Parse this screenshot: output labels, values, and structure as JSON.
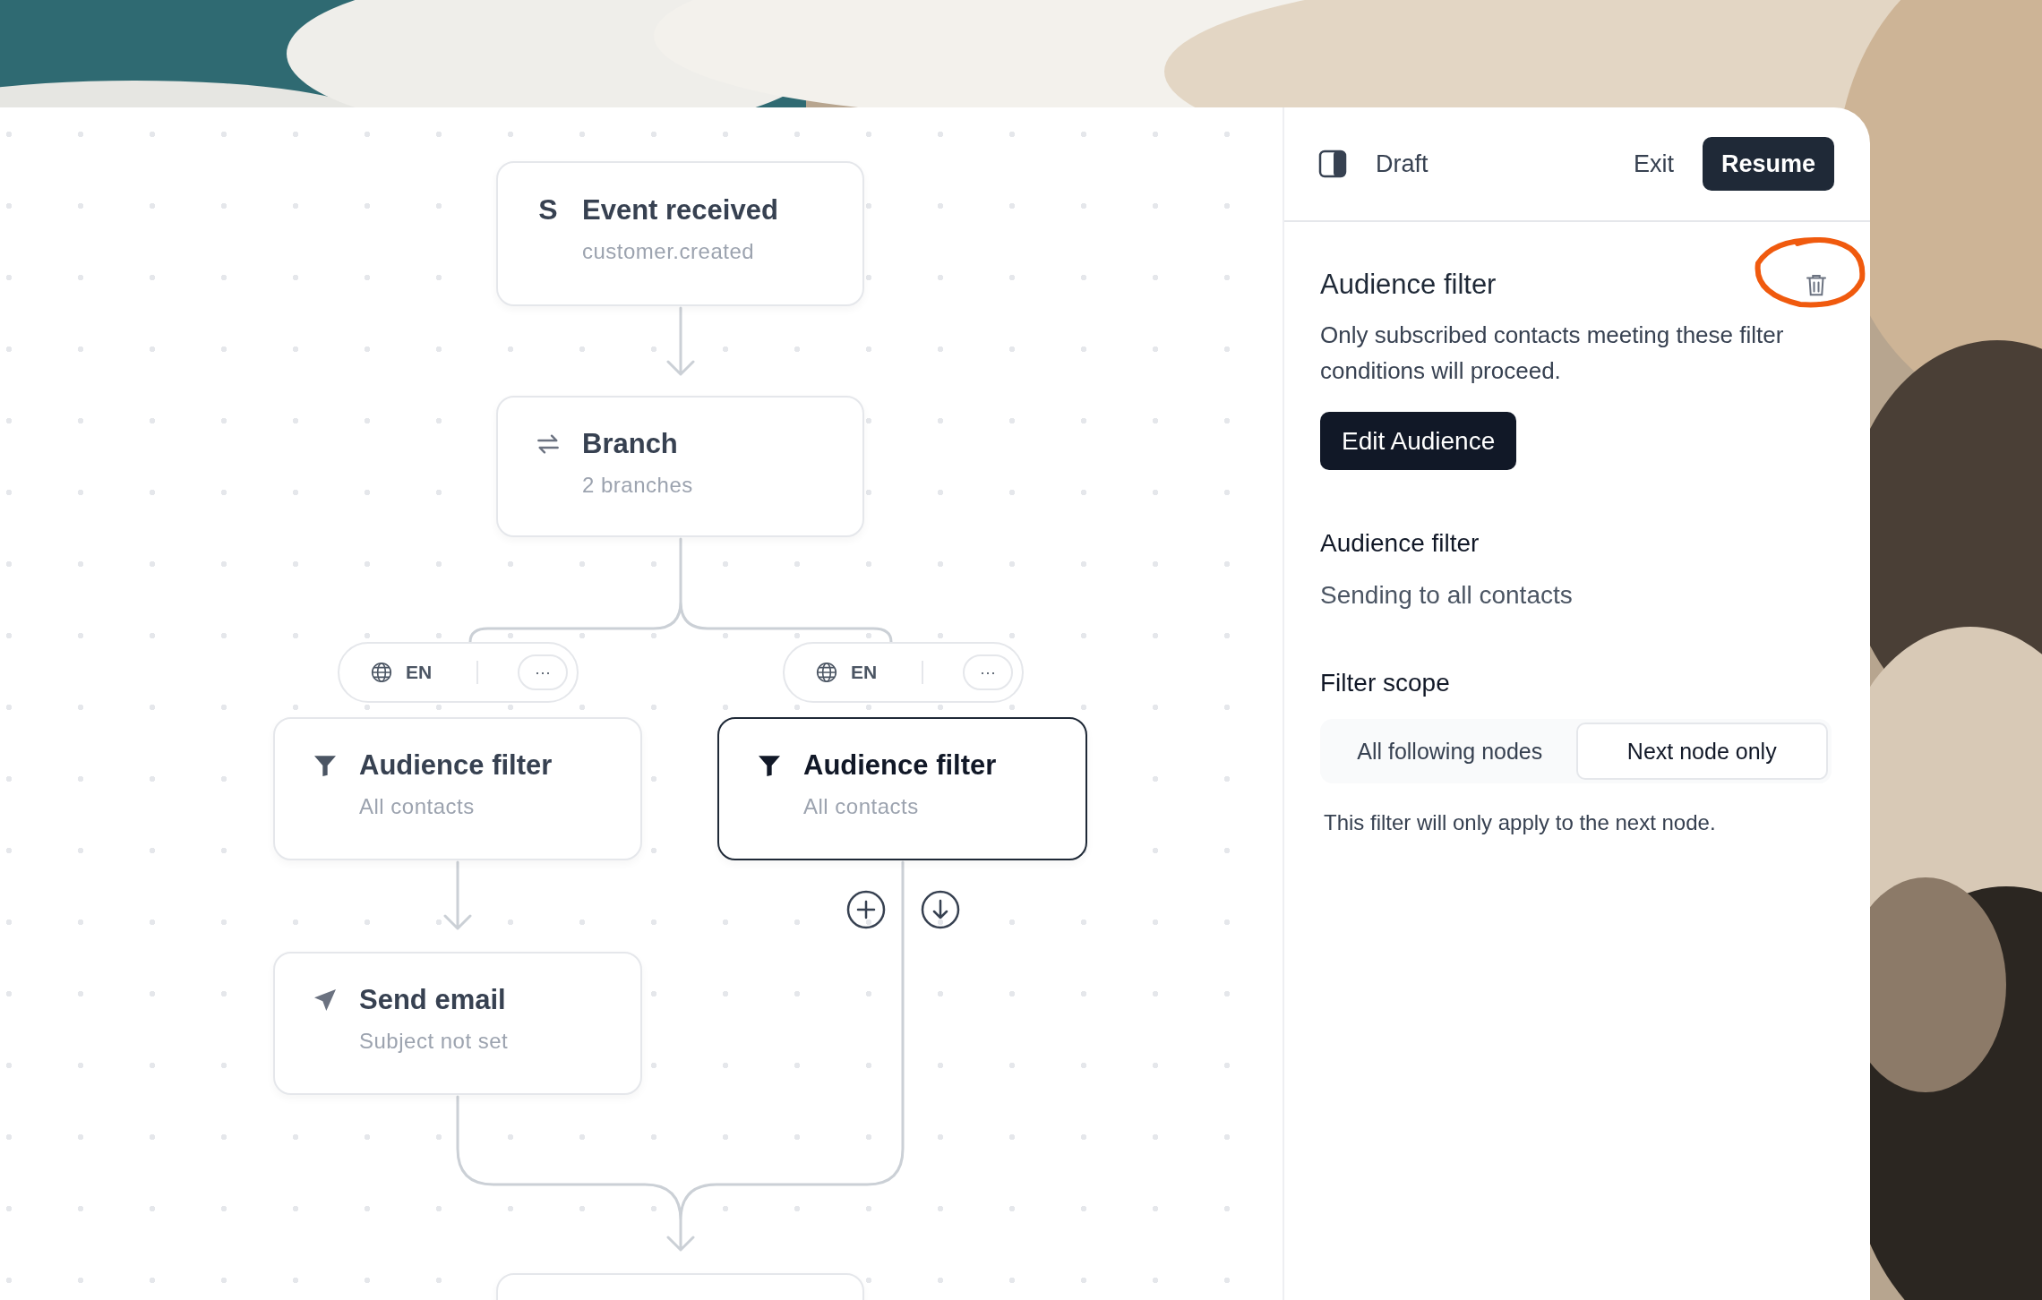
{
  "editor": {
    "nodes": [
      {
        "kind": "event",
        "source": "S",
        "title": "Event received",
        "subtitle": "customer.created",
        "selected": false
      },
      {
        "kind": "branch",
        "title": "Branch",
        "subtitle": "2 branches",
        "selected": false
      },
      {
        "kind": "filter",
        "title": "Audience filter",
        "subtitle": "All contacts",
        "selected": false
      },
      {
        "kind": "filter",
        "title": "Audience filter",
        "subtitle": "All contacts",
        "selected": true
      },
      {
        "kind": "email",
        "title": "Send email",
        "subtitle": "Subject not set",
        "selected": false
      },
      {
        "kind": "partial",
        "selected": false
      }
    ],
    "branch_pills": [
      {
        "language": "EN",
        "more": "···"
      },
      {
        "language": "EN",
        "more": "···"
      }
    ]
  },
  "panel": {
    "header": {
      "status": "Draft",
      "exit": "Exit",
      "resume": "Resume"
    },
    "section": {
      "title": "Audience filter",
      "description": "Only subscribed contacts meeting these filter conditions will proceed.",
      "button": "Edit Audience"
    },
    "audience": {
      "label": "Audience filter",
      "value": "Sending to all contacts"
    },
    "scope": {
      "label": "Filter scope",
      "options": [
        {
          "label": "All following nodes",
          "selected": false
        },
        {
          "label": "Next node only",
          "selected": true
        }
      ],
      "hint": "This filter will only apply to the next node."
    }
  }
}
